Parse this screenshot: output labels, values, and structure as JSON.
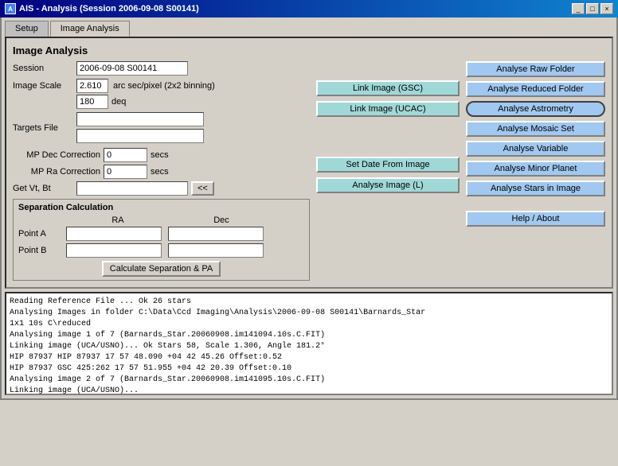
{
  "window": {
    "title": "AIS - Analysis (Session 2006-09-08 S00141)",
    "icon": "A"
  },
  "tabs": [
    {
      "label": "Setup",
      "active": false
    },
    {
      "label": "Image Analysis",
      "active": true
    }
  ],
  "section_title": "Image Analysis",
  "form": {
    "session_label": "Session",
    "session_value": "2006-09-08 S00141",
    "image_scale_label": "Image Scale",
    "scale_value": "2.610",
    "deg_value": "180",
    "arc_unit": "arc sec/pixel (2x2 binning)",
    "deg_unit": "deq",
    "targets_label": "Targets File",
    "targets_value1": "",
    "targets_value2": "",
    "getvtbt_label": "Get Vt, Bt",
    "getvtbt_value": "",
    "arrow_btn": "<<",
    "mp_dec_label": "MP Dec Correction",
    "mp_dec_value": "0",
    "mp_dec_unit": "secs",
    "mp_ra_label": "MP Ra Correction",
    "mp_ra_value": "0",
    "mp_ra_unit": "secs"
  },
  "buttons_middle": {
    "link_gsc": "Link Image (GSC)",
    "link_ucac": "Link Image (UCAC)",
    "set_date": "Set Date From Image",
    "analyse_l": "Analyse Image (L)"
  },
  "buttons_right": {
    "analyse_raw": "Analyse Raw Folder",
    "analyse_reduced": "Analyse Reduced Folder",
    "analyse_astrometry": "Analyse Astrometry",
    "analyse_mosaic": "Analyse Mosaic Set",
    "analyse_variable": "Analyse Variable",
    "analyse_minor": "Analyse Minor Planet",
    "analyse_stars": "Analyse Stars in Image",
    "help_about": "Help / About"
  },
  "separation": {
    "title": "Separation Calculation",
    "ra_header": "RA",
    "dec_header": "Dec",
    "point_a": "Point A",
    "point_b": "Point B",
    "point_a_ra": "",
    "point_a_dec": "",
    "point_b_ra": "",
    "point_b_dec": "",
    "calc_btn": "Calculate Separation & PA"
  },
  "log": {
    "lines": [
      "Reading Reference File ... Ok         26 stars",
      "Analysing Images in folder C:\\Data\\Ccd Imaging\\Analysis\\2006-09-08 S00141\\Barnards_Star",
      "1x1 10s C\\reduced",
      "Analysing image 1 of 7 (Barnards_Star.20060908.im141094.10s.C.FIT)",
      "Linking image (UCA/USNO)... Ok     Stars 58, Scale 1.306, Angle 181.2°",
      "HIP 87937        HIP 87937       17 57 48.090  +04 42 45.26  Offset:0.52",
      "HIP 87937        GSC 425:262     17 57 51.955  +04 42 20.39  Offset:0.10",
      "Analysing image 2 of 7 (Barnards_Star.20060908.im141095.10s.C.FIT)",
      "Linking image (UCA/USNO)..."
    ]
  }
}
